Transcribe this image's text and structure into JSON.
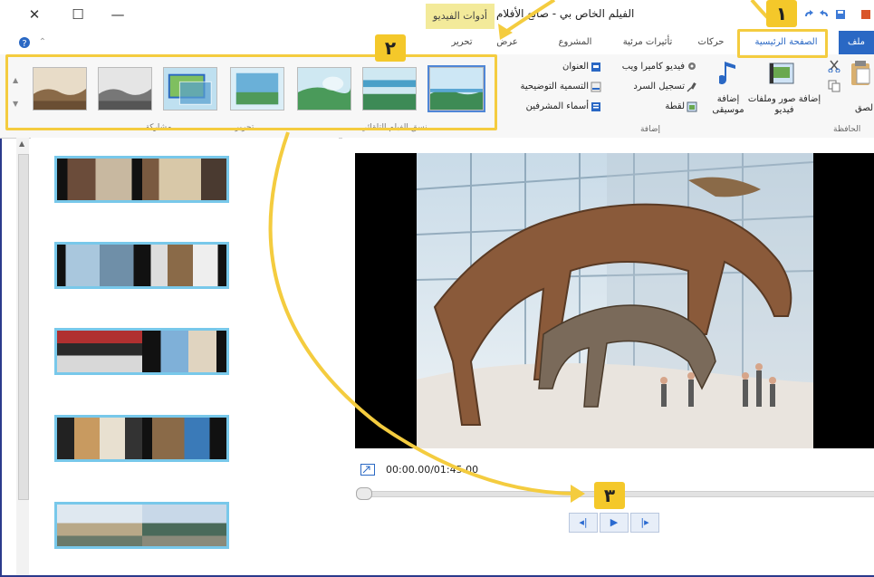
{
  "window": {
    "title": "الفيلم الخاص بي - صانع الأفلام",
    "contextual_tab": "أدوات الفيديو",
    "controls": {
      "close": "✕",
      "maximize": "☐",
      "minimize": "—"
    }
  },
  "tabs": {
    "file": "ملف",
    "home": "الصفحة الرئيسية",
    "animations": "حركات",
    "visual_effects": "تأثيرات مرئية",
    "project": "المشروع",
    "view": "عرض",
    "edit": "تحرير"
  },
  "ribbon": {
    "clipboard": {
      "paste": "لصق",
      "label": "الحافظة"
    },
    "add": {
      "add_videos_photos": "إضافة صور وملفات فيديو",
      "add_music": "إضافة موسيقى",
      "webcam_video": "فيديو كاميرا ويب",
      "record_narration": "تسجيل السرد",
      "snapshot": "لقطة",
      "title": "العنوان",
      "caption": "التسمية التوضيحية",
      "credits": "أسماء المشرفين",
      "label": "إضافة"
    },
    "groups": {
      "autotheme": "نسق الفيلم التلقائي",
      "edit": "تحرير",
      "share": "مشاركة"
    }
  },
  "badges": {
    "one": "١",
    "two": "٢",
    "three": "٣"
  },
  "player": {
    "time": "00:00.00/01:45.00"
  },
  "colors": {
    "highlight": "#f4cc3f",
    "accent": "#2a68c4",
    "clip_border": "#78c8ea"
  }
}
